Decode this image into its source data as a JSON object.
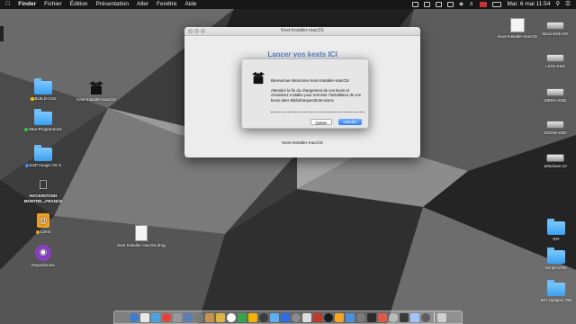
{
  "menubar": {
    "apple_icon": "",
    "items": [
      "Finder",
      "Fichier",
      "Édition",
      "Présentation",
      "Aller",
      "Fenêtre",
      "Aide"
    ],
    "datetime": "Mar. 6 mai  11:54"
  },
  "desktop_left": [
    {
      "label": "BUILD-CS2",
      "icon": "folder-icon",
      "dot": "#f5c400"
    },
    {
      "label": "Mes-Programmes",
      "icon": "folder-icon",
      "dot": "#3ec43e"
    },
    {
      "label": "ESP Image OS X",
      "icon": "folder-icon",
      "dot": "#3a8ef6"
    },
    {
      "label": "HACKINTOSH MONTRE...FRANCE",
      "icon": "apple-logo-icon"
    },
    {
      "label": "Liens",
      "icon": "contacts-icon",
      "dot": "#f0a020"
    },
    {
      "label": "Repositories",
      "icon": "github-icon"
    }
  ],
  "desktop_mid": [
    {
      "label": "Kext-Installer-macOS",
      "icon": "kext-installer-icon"
    },
    {
      "label": "Kext Installer macOS.dmg",
      "icon": "dmg-file-icon"
    }
  ],
  "desktop_right": [
    {
      "label": "Kext-Installer-macOS",
      "icon": "package-icon"
    },
    {
      "label": "Macintosh-HD",
      "icon": "drive-icon"
    },
    {
      "label": "LION-SSD",
      "icon": "drive-icon"
    },
    {
      "label": "SIERA-SSD",
      "icon": "drive-icon"
    },
    {
      "label": "SNOW-SSD",
      "icon": "drive-icon"
    },
    {
      "label": "Windows-10",
      "icon": "drive-icon"
    },
    {
      "label": "EFI",
      "icon": "folder-icon"
    },
    {
      "label": "Script-UNIX",
      "icon": "folder-icon"
    },
    {
      "label": "EFI Optiplex 790",
      "icon": "folder-icon"
    }
  ],
  "window": {
    "title": "Kext-Installer-macOS",
    "heading": "Lancer vos kexts ICI",
    "footer": "Kext-Installer-macOS"
  },
  "dialog": {
    "title": "Bienvenue Welcome Kext-Installer-macOS",
    "body": "Attendez la fin du chargement de vos kexts et choisissez Installer pour terminer l'installation de vos kexts dans Bibliothèques/Extensions",
    "quit_label": "Quitter",
    "install_label": "Installer"
  },
  "dock": {
    "colors": [
      "#3a7bd5",
      "#e8e8e8",
      "#4aa3df",
      "#e94235",
      "#999999",
      "#5b7fb5",
      "#7a7a7a",
      "#c6934b",
      "#e0b441",
      "#ffffff",
      "#37a34a",
      "#f2b400",
      "#3d3d3d",
      "#5ab0f0",
      "#2e6de0",
      "#8a8a8a",
      "#dddddd",
      "#c0392b",
      "#1c1c1c",
      "#f5a623",
      "#4a90e2",
      "#7b7b7b",
      "#2d2d2d",
      "#e05a47",
      "#bbbbbb",
      "#3a3a3a",
      "#a0c4ff",
      "#5d5d5d"
    ],
    "trash_color": "#cfcfcf"
  }
}
